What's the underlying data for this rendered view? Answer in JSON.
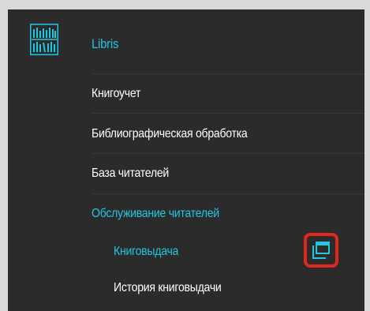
{
  "app": {
    "title": "Libris",
    "logo_icon": "library-books-icon"
  },
  "nav": {
    "items": [
      {
        "label": "Книгоучет",
        "active": false,
        "level": 0
      },
      {
        "label": "Библиографическая обработка",
        "active": false,
        "level": 0
      },
      {
        "label": "База читателей",
        "active": false,
        "level": 0
      },
      {
        "label": "Обслуживание читателей",
        "active": true,
        "level": 0
      },
      {
        "label": "Книговыдача",
        "active": true,
        "level": 1
      },
      {
        "label": "История книговыдачи",
        "active": false,
        "level": 1
      }
    ]
  },
  "actions": {
    "open_new_window_icon": "open-in-new-window-icon",
    "highlight_color": "#e0281f"
  },
  "colors": {
    "background": "#2b2b2b",
    "accent": "#1fc7e0",
    "text": "#ffffff"
  }
}
